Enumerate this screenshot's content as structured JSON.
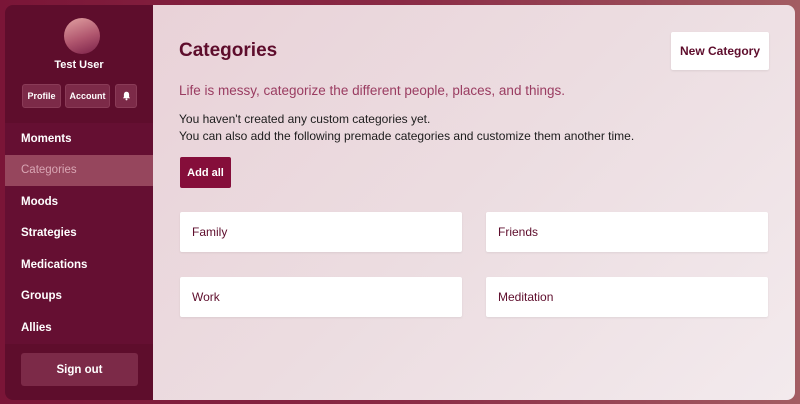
{
  "user": {
    "name": "Test User"
  },
  "sidebar": {
    "buttons": {
      "profile": "Profile",
      "account": "Account",
      "notifications_icon": "bell-icon"
    },
    "nav": [
      {
        "label": "Moments",
        "active": false
      },
      {
        "label": "Categories",
        "active": true
      },
      {
        "label": "Moods",
        "active": false
      },
      {
        "label": "Strategies",
        "active": false
      },
      {
        "label": "Medications",
        "active": false
      },
      {
        "label": "Groups",
        "active": false
      },
      {
        "label": "Allies",
        "active": false
      }
    ],
    "sign_out": "Sign out"
  },
  "main": {
    "title": "Categories",
    "new_category_label": "New Category",
    "subtitle": "Life is messy, categorize the different people, places, and things.",
    "info_line1": "You haven't created any custom categories yet.",
    "info_line2": "You can also add the following premade categories and customize them another time.",
    "add_all_label": "Add all",
    "cards": [
      "Family",
      "Friends",
      "Work",
      "Meditation"
    ]
  },
  "colors": {
    "primary": "#5e0d2c",
    "accent": "#850e3a",
    "subtitle": "#9a3c61",
    "active_nav": "#96465d"
  }
}
